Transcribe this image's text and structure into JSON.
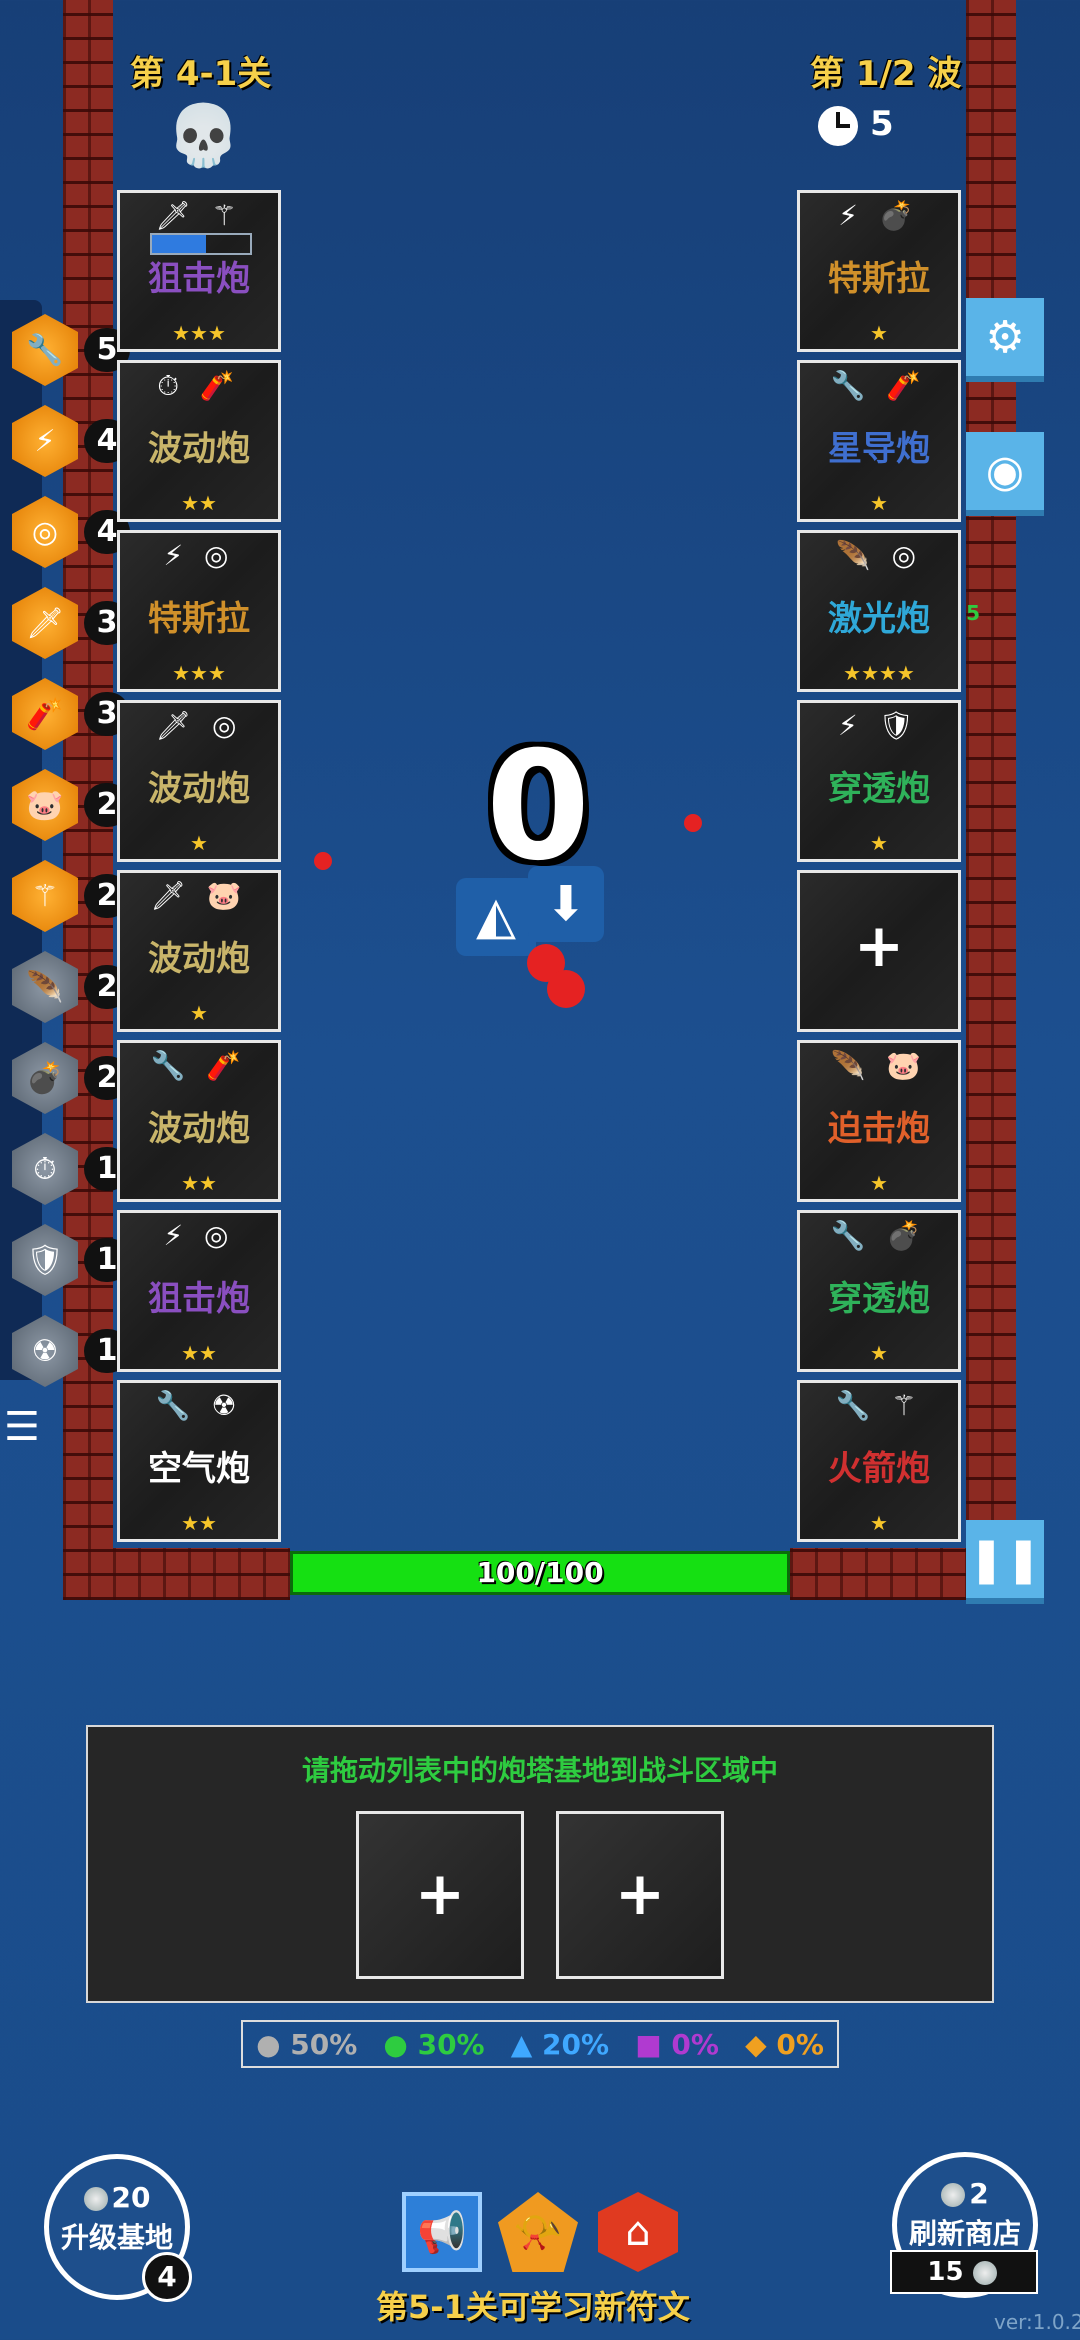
{
  "header": {
    "stage": "第 4-1关",
    "wave": "第 1/2 波",
    "timer": "5"
  },
  "left_towers": [
    {
      "icons": "🗡 ⚚",
      "name": "狙击炮",
      "color": "#8a4fc0",
      "stars": "★★★",
      "progress": 0.55
    },
    {
      "icons": "⏱ 🧨",
      "name": "波动炮",
      "color": "#c9b56a",
      "stars": "★★"
    },
    {
      "icons": "⚡ ◎",
      "name": "特斯拉",
      "color": "#d0902a",
      "stars": "★★★"
    },
    {
      "icons": "🗡 ◎",
      "name": "波动炮",
      "color": "#c9b56a",
      "stars": "★"
    },
    {
      "icons": "🗡 🐷",
      "name": "波动炮",
      "color": "#c9b56a",
      "stars": "★"
    },
    {
      "icons": "🔧 🧨",
      "name": "波动炮",
      "color": "#c9b56a",
      "stars": "★★"
    },
    {
      "icons": "⚡ ◎",
      "name": "狙击炮",
      "color": "#8a4fc0",
      "stars": "★★"
    },
    {
      "icons": "🔧 ☢",
      "name": "空气炮",
      "color": "#ffffff",
      "stars": "★★"
    }
  ],
  "right_towers": [
    {
      "icons": "⚡ 💣",
      "name": "特斯拉",
      "color": "#d0902a",
      "stars": "★"
    },
    {
      "icons": "🔧 🧨",
      "name": "星导炮",
      "color": "#3f6fd0",
      "stars": "★"
    },
    {
      "icons": "🪶 ◎",
      "name": "激光炮",
      "color": "#2fa8d8",
      "stars": "★★★★",
      "level": "5"
    },
    {
      "icons": "⚡ 🛡",
      "name": "穿透炮",
      "color": "#2fb25a",
      "stars": "★"
    },
    {
      "plus": "+"
    },
    {
      "icons": "🪶 🐷",
      "name": "迫击炮",
      "color": "#e0602a",
      "stars": "★"
    },
    {
      "icons": "🔧 💣",
      "name": "穿透炮",
      "color": "#2fb25a",
      "stars": "★"
    },
    {
      "icons": "🔧 ⚚",
      "name": "火箭炮",
      "color": "#d03030",
      "stars": "★"
    }
  ],
  "runes": [
    {
      "icon": "🔧",
      "count": "5",
      "tier": "gold"
    },
    {
      "icon": "⚡",
      "count": "4",
      "tier": "gold"
    },
    {
      "icon": "◎",
      "count": "4",
      "tier": "gold"
    },
    {
      "icon": "🗡",
      "count": "3",
      "tier": "gold"
    },
    {
      "icon": "🧨",
      "count": "3",
      "tier": "gold"
    },
    {
      "icon": "🐷",
      "count": "2",
      "tier": "gold"
    },
    {
      "icon": "⚚",
      "count": "2",
      "tier": "gold"
    },
    {
      "icon": "🪶",
      "count": "2",
      "tier": "gray"
    },
    {
      "icon": "💣",
      "count": "2",
      "tier": "gray"
    },
    {
      "icon": "⏱",
      "count": "1",
      "tier": "gray"
    },
    {
      "icon": "🛡",
      "count": "1",
      "tier": "gray"
    },
    {
      "icon": "☢",
      "count": "1",
      "tier": "gray"
    }
  ],
  "center": {
    "score": "0"
  },
  "hp": {
    "text": "100/100",
    "fraction": 1.0
  },
  "panel": {
    "message": "请拖动列表中的炮塔基地到战斗区域中",
    "slot1": "+",
    "slot2": "+"
  },
  "odds": [
    {
      "label": "● 50%",
      "color": "#b0b0b0"
    },
    {
      "label": "● 30%",
      "color": "#2ecc40"
    },
    {
      "label": "▲ 20%",
      "color": "#3fa8ff"
    },
    {
      "label": "■ 0%",
      "color": "#b03ad0"
    },
    {
      "label": "◆ 0%",
      "color": "#f0a020"
    }
  ],
  "upgrade": {
    "cost": "20",
    "label": "升级基地",
    "level": "4"
  },
  "refresh": {
    "cost": "2",
    "label": "刷新商店",
    "coins": "15"
  },
  "footer": {
    "hint": "第5-1关可学习新符文",
    "version": "ver:1.0.2"
  }
}
